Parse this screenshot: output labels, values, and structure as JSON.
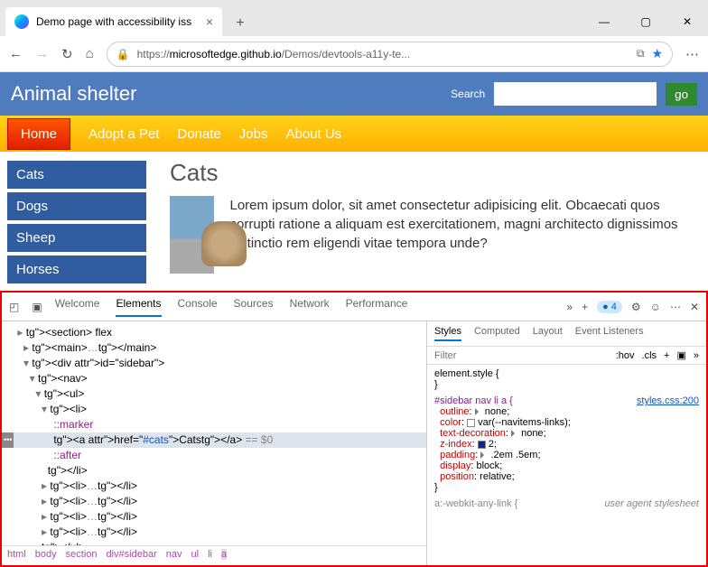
{
  "browser": {
    "tab_title": "Demo page with accessibility iss",
    "url_prefix": "https://",
    "url_host": "microsoftedge.github.io",
    "url_path": "/Demos/devtools-a11y-te..."
  },
  "site": {
    "title": "Animal shelter",
    "search_label": "Search",
    "search_button": "go",
    "nav": [
      "Home",
      "Adopt a Pet",
      "Donate",
      "Jobs",
      "About Us"
    ],
    "sidebar": [
      "Cats",
      "Dogs",
      "Sheep",
      "Horses"
    ],
    "heading": "Cats",
    "body": "Lorem ipsum dolor, sit amet consectetur adipisicing elit. Obcaecati quos corrupti ratione a aliquam est exercitationem, magni architecto dignissimos distinctio rem eligendi vitae tempora unde?"
  },
  "devtools": {
    "panels": [
      "Welcome",
      "Elements",
      "Console",
      "Sources",
      "Network",
      "Performance"
    ],
    "issues_count": 4,
    "dom_lines": [
      {
        "i": 2,
        "t": "arr_r",
        "txt": "<section> flex"
      },
      {
        "i": 3,
        "t": "arr_r",
        "txt": "<main>…</main>"
      },
      {
        "i": 3,
        "t": "arr_d",
        "txt": "<div id=\"sidebar\">"
      },
      {
        "i": 4,
        "t": "arr_d",
        "txt": "<nav>"
      },
      {
        "i": 5,
        "t": "arr_d",
        "txt": "<ul>"
      },
      {
        "i": 6,
        "t": "arr_d",
        "txt": "<li>"
      },
      {
        "i": 7,
        "t": "pseudo",
        "txt": "::marker"
      },
      {
        "i": 7,
        "t": "sel",
        "txt": "<a href=\"#cats\">Cats</a> == $0"
      },
      {
        "i": 7,
        "t": "pseudo",
        "txt": "::after"
      },
      {
        "i": 6,
        "t": "",
        "txt": "</li>"
      },
      {
        "i": 6,
        "t": "arr_r",
        "txt": "<li>…</li>"
      },
      {
        "i": 6,
        "t": "arr_r",
        "txt": "<li>…</li>"
      },
      {
        "i": 6,
        "t": "arr_r",
        "txt": "<li>…</li>"
      },
      {
        "i": 6,
        "t": "arr_r",
        "txt": "<li>…</li>"
      },
      {
        "i": 5,
        "t": "",
        "txt": "</ul>"
      }
    ],
    "crumbs": [
      "html",
      "body",
      "section",
      "div#sidebar",
      "nav",
      "ul",
      "li",
      "a"
    ],
    "style_tabs": [
      "Styles",
      "Computed",
      "Layout",
      "Event Listeners"
    ],
    "filter_placeholder": "Filter",
    "hov": ":hov",
    "cls": ".cls",
    "rules": {
      "elstyle": "element.style {",
      "selector": "#sidebar nav li a {",
      "source": "styles.css:200",
      "props": [
        {
          "p": "outline",
          "v": "none",
          "tri": true
        },
        {
          "p": "color",
          "v": "var(--navitems-links)",
          "sw": "#fff"
        },
        {
          "p": "text-decoration",
          "v": "none",
          "tri": true
        },
        {
          "p": "z-index",
          "v": "2",
          "sw": "#1a237e"
        },
        {
          "p": "padding",
          "v": ".2em .5em",
          "tri": true
        },
        {
          "p": "display",
          "v": "block"
        },
        {
          "p": "position",
          "v": "relative"
        }
      ],
      "ua_sel": "a:-webkit-any-link {",
      "ua_label": "user agent stylesheet"
    }
  }
}
